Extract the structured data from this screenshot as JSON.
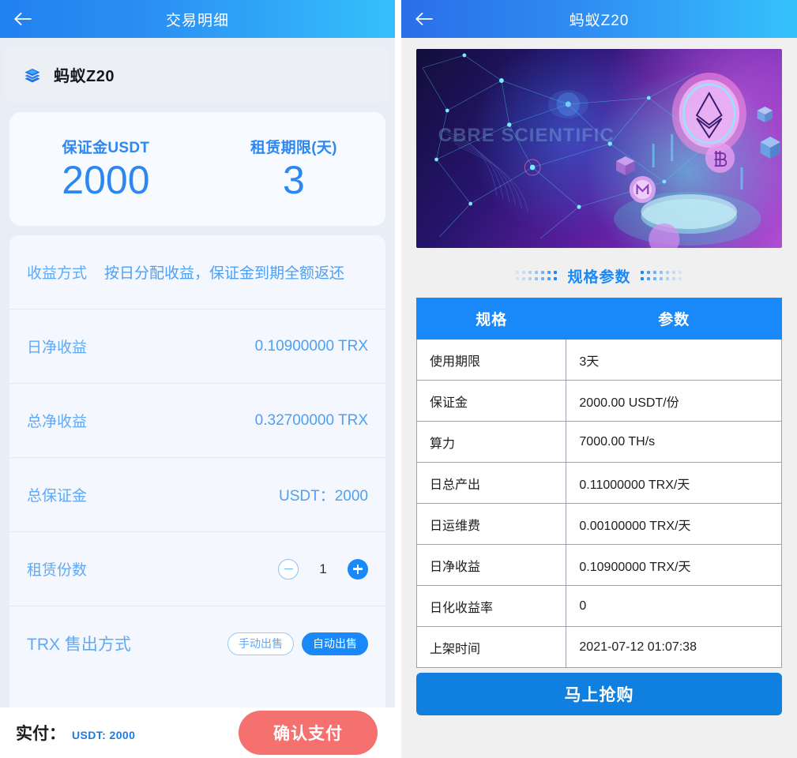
{
  "colors": {
    "brand_blue": "#1989fa",
    "nav_gradient_start": "#2281f0",
    "nav_gradient_end": "#34c0fb",
    "light_blue_text": "#5fa9f5",
    "pay_button_red": "#f4716f",
    "panel_bg": "#e9edf5",
    "card_bg": "#f7fafe"
  },
  "left_panel": {
    "nav": {
      "back_icon": "arrow-left-icon",
      "title": "交易明细"
    },
    "product": {
      "icon": "layers-stack-icon",
      "name": "蚂蚁Z20"
    },
    "stats": [
      {
        "label": "保证金USDT",
        "value": "2000"
      },
      {
        "label": "租赁期限(天)",
        "value": "3"
      }
    ],
    "details": [
      {
        "label": "收益方式",
        "value": "按日分配收益，保证金到期全额返还",
        "layout": "inline"
      },
      {
        "label": "日净收益",
        "value": "0.10900000 TRX",
        "layout": "split"
      },
      {
        "label": "总净收益",
        "value": "0.32700000 TRX",
        "layout": "split"
      },
      {
        "label": "总保证金",
        "value": "USDT：2000",
        "layout": "split"
      }
    ],
    "quantity_row": {
      "label": "租赁份数",
      "minus_icon": "minus-circle-icon",
      "plus_icon": "plus-circle-icon",
      "value": "1"
    },
    "sell_method_row": {
      "label": "TRX 售出方式",
      "options": [
        {
          "label": "手动出售",
          "selected": false
        },
        {
          "label": "自动出售",
          "selected": true
        }
      ]
    },
    "paybar": {
      "title": "实付：",
      "amount": "USDT: 2000",
      "button_label": "确认支付"
    }
  },
  "right_panel": {
    "nav": {
      "back_icon": "arrow-left-icon",
      "title": "蚂蚁Z20"
    },
    "banner": {
      "watermark": "CBRE SCIENTIFIC",
      "alt": "blockchain network illustration with ethereum and monero coins"
    },
    "section_title": "规格参数",
    "table": {
      "headers": [
        "规格",
        "参数"
      ],
      "rows": [
        [
          "使用期限",
          "3天"
        ],
        [
          "保证金",
          "2000.00 USDT/份"
        ],
        [
          "算力",
          "7000.00 TH/s"
        ],
        [
          "日总产出",
          "0.11000000 TRX/天"
        ],
        [
          "日运维费",
          "0.00100000 TRX/天"
        ],
        [
          "日净收益",
          "0.10900000 TRX/天"
        ],
        [
          "日化收益率",
          "0"
        ],
        [
          "上架时间",
          "2021-07-12 01:07:38"
        ]
      ]
    },
    "buy_button_label": "马上抢购"
  }
}
